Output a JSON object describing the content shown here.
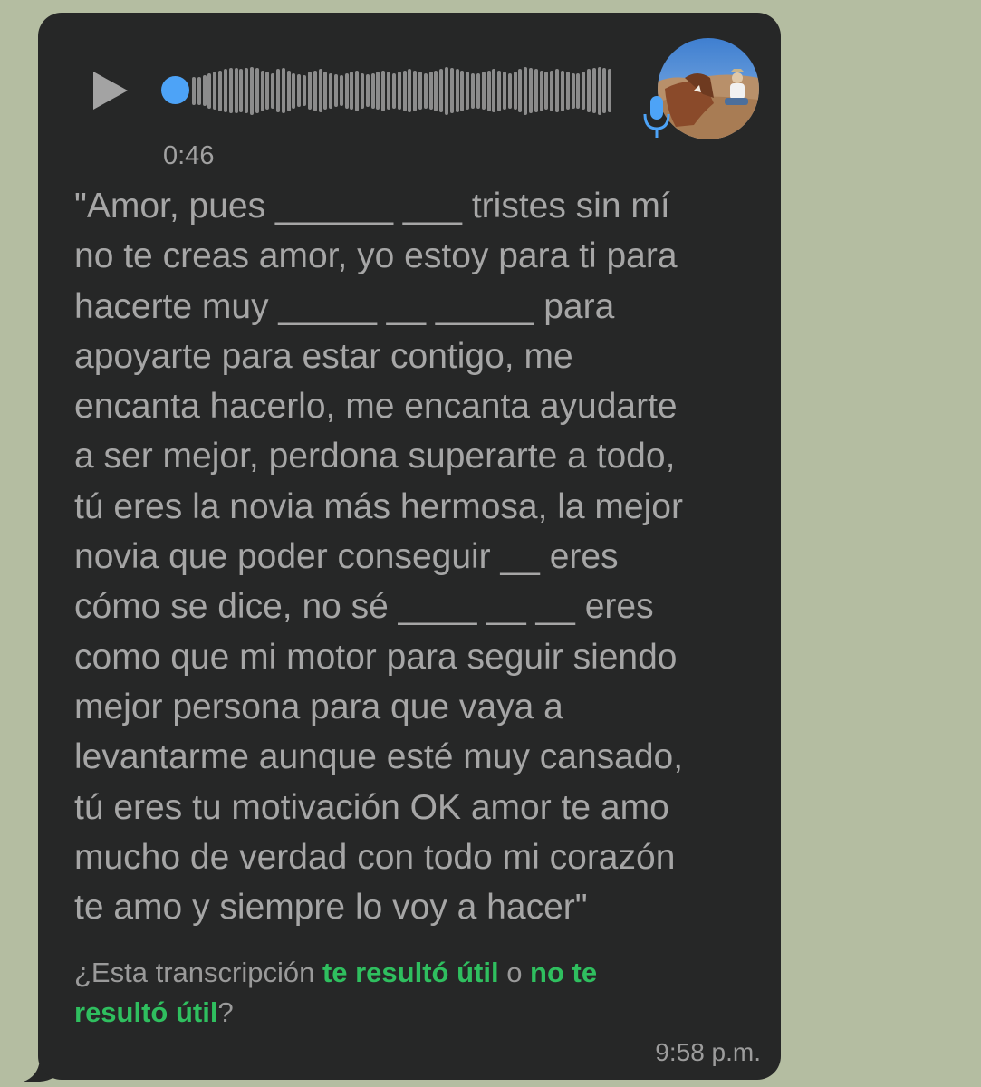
{
  "message": {
    "duration": "0:46",
    "transcript_lines": [
      "\"Amor, pues ______ ___ tristes sin mí",
      "no te creas amor, yo estoy para ti para",
      "hacerte muy _____ __ _____ para",
      "apoyarte para estar contigo, me",
      "encanta hacerlo, me encanta ayudarte",
      "a ser mejor, perdona superarte a todo,",
      "tú eres la novia más hermosa, la mejor",
      "novia que poder conseguir __ eres",
      "cómo se dice, no sé ____ __ __ eres",
      "como que mi motor para seguir siendo",
      "mejor persona para que vaya a",
      "levantarme aunque esté muy cansado,",
      "tú eres tu motivación OK amor te amo",
      "mucho de verdad con todo mi corazón",
      "te amo y siempre lo voy a hacer\""
    ],
    "feedback": {
      "prefix": "¿Esta transcripción ",
      "useful_link": "te resultó útil",
      "middle": " o ",
      "not_useful_link_line1": "no te",
      "not_useful_link_line2": "resultó útil",
      "suffix": "?"
    },
    "timestamp": "9:58 p.m."
  },
  "icons": {
    "play": "play-icon",
    "mic": "microphone-icon",
    "avatar": "contact-avatar"
  },
  "colors": {
    "background": "#b4bda1",
    "bubble": "#262727",
    "accent_blue": "#4da3f7",
    "link_green": "#2fbf5f"
  },
  "waveform_levels": [
    0.55,
    0.55,
    0.6,
    0.7,
    0.75,
    0.8,
    0.85,
    0.9,
    0.9,
    0.85,
    0.9,
    0.95,
    0.9,
    0.8,
    0.75,
    0.7,
    0.85,
    0.9,
    0.8,
    0.7,
    0.65,
    0.6,
    0.75,
    0.8,
    0.85,
    0.75,
    0.7,
    0.65,
    0.6,
    0.7,
    0.75,
    0.8,
    0.7,
    0.65,
    0.7,
    0.75,
    0.8,
    0.75,
    0.7,
    0.75,
    0.8,
    0.85,
    0.8,
    0.75,
    0.7,
    0.75,
    0.8,
    0.85,
    0.95,
    0.9,
    0.85,
    0.8,
    0.75,
    0.7,
    0.7,
    0.75,
    0.8,
    0.85,
    0.8,
    0.75,
    0.7,
    0.75,
    0.85,
    0.95,
    0.9,
    0.85,
    0.8,
    0.75,
    0.8,
    0.85,
    0.8,
    0.75,
    0.7,
    0.7,
    0.75,
    0.85,
    0.9,
    0.95,
    0.9,
    0.85
  ]
}
